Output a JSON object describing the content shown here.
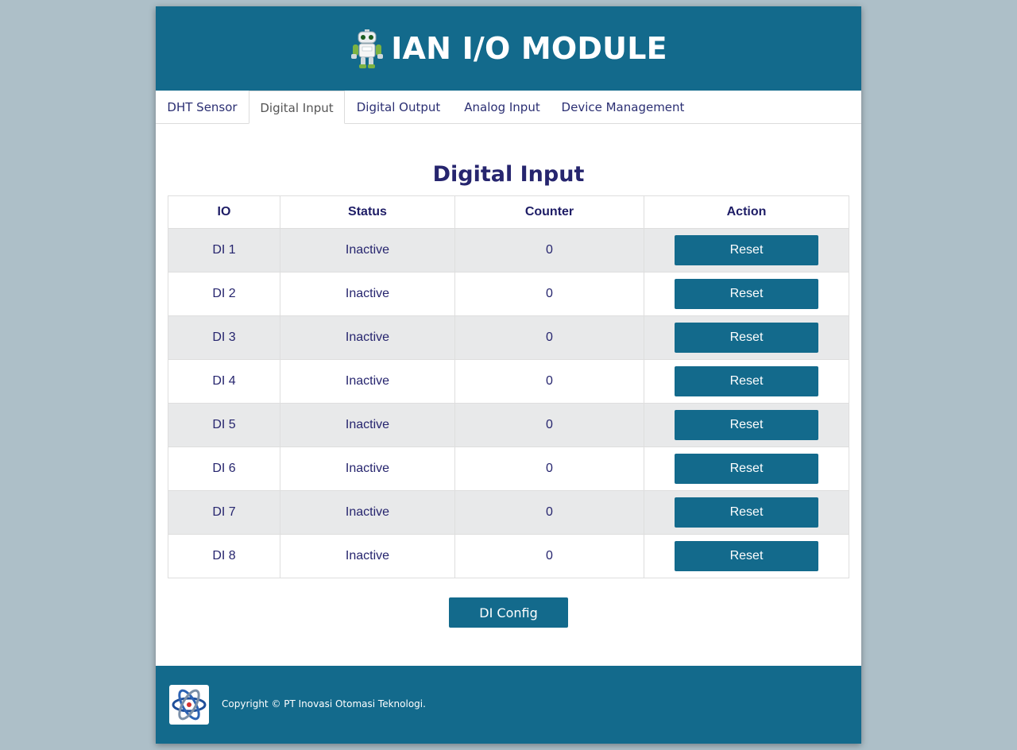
{
  "header": {
    "title": "IAN I/O MODULE"
  },
  "nav": {
    "tabs": [
      {
        "label": "DHT Sensor",
        "active": false
      },
      {
        "label": "Digital Input",
        "active": true
      },
      {
        "label": "Digital Output",
        "active": false
      },
      {
        "label": "Analog Input",
        "active": false
      },
      {
        "label": "Device Management",
        "active": false
      }
    ]
  },
  "main": {
    "title": "Digital Input",
    "table": {
      "columns": [
        "IO",
        "Status",
        "Counter",
        "Action"
      ],
      "rows": [
        {
          "io": "DI 1",
          "status": "Inactive",
          "counter": "0",
          "action": "Reset"
        },
        {
          "io": "DI 2",
          "status": "Inactive",
          "counter": "0",
          "action": "Reset"
        },
        {
          "io": "DI 3",
          "status": "Inactive",
          "counter": "0",
          "action": "Reset"
        },
        {
          "io": "DI 4",
          "status": "Inactive",
          "counter": "0",
          "action": "Reset"
        },
        {
          "io": "DI 5",
          "status": "Inactive",
          "counter": "0",
          "action": "Reset"
        },
        {
          "io": "DI 6",
          "status": "Inactive",
          "counter": "0",
          "action": "Reset"
        },
        {
          "io": "DI 7",
          "status": "Inactive",
          "counter": "0",
          "action": "Reset"
        },
        {
          "io": "DI 8",
          "status": "Inactive",
          "counter": "0",
          "action": "Reset"
        }
      ]
    },
    "config_button": "DI Config"
  },
  "footer": {
    "copyright": "Copyright © PT Inovasi Otomasi Teknologi.",
    "logo_icon": "atom-logo-icon"
  },
  "icons": {
    "header_logo": "robot-icon"
  },
  "colors": {
    "primary": "#136a8c",
    "background": "#adbfc8",
    "heading_text": "#26256e",
    "striped_row": "#e8e9ea"
  }
}
